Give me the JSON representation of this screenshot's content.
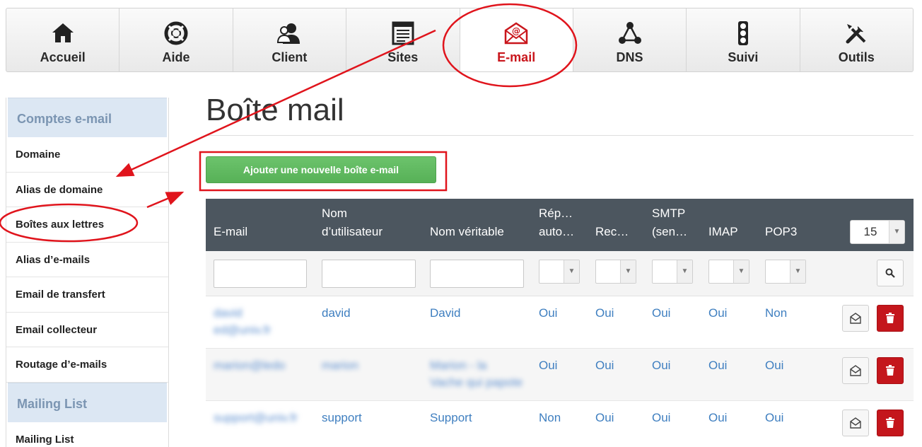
{
  "nav": {
    "items": [
      {
        "label": "Accueil",
        "icon": "home-icon"
      },
      {
        "label": "Aide",
        "icon": "lifebuoy-icon"
      },
      {
        "label": "Client",
        "icon": "users-icon"
      },
      {
        "label": "Sites",
        "icon": "site-icon"
      },
      {
        "label": "E-mail",
        "icon": "email-icon",
        "active": true
      },
      {
        "label": "DNS",
        "icon": "dns-icon"
      },
      {
        "label": "Suivi",
        "icon": "traffic-light-icon"
      },
      {
        "label": "Outils",
        "icon": "tools-icon"
      }
    ]
  },
  "sidebar": {
    "section1": "Comptes e-mail",
    "items": [
      "Domaine",
      "Alias de domaine",
      "Boîtes aux lettres",
      "Alias d’e-mails",
      "Email de transfert",
      "Email collecteur",
      "Routage d’e-mails"
    ],
    "section2": "Mailing List",
    "items2": [
      "Mailing List"
    ]
  },
  "main": {
    "title": "Boîte mail",
    "add_button": "Ajouter une nouvelle boîte e-mail"
  },
  "grid": {
    "headers": {
      "email": "E-mail",
      "username_l1": "Nom",
      "username_l2": "d’utilisateur",
      "realname": "Nom véritable",
      "autoreply_l1": "Rép…",
      "autoreply_l2": "auto…",
      "rec": "Rec…",
      "smtp_l1": "SMTP",
      "smtp_l2": "(sen…",
      "imap": "IMAP",
      "pop3": "POP3"
    },
    "page_size": "15",
    "rows": [
      {
        "email_l1": "david",
        "email_l2": "ed@univ.fr",
        "username": "david",
        "realname_l1": "David",
        "realname_l2": "",
        "autoreply": "Oui",
        "rec": "Oui",
        "smtp": "Oui",
        "imap": "Oui",
        "pop3": "Non"
      },
      {
        "email_l1": "marion@ledo",
        "email_l2": "",
        "username": "marion",
        "realname_l1": "Marion - la",
        "realname_l2": "Vache qui papote",
        "autoreply": "Oui",
        "rec": "Oui",
        "smtp": "Oui",
        "imap": "Oui",
        "pop3": "Oui"
      },
      {
        "email_l1": "support@univ.fr",
        "email_l2": "",
        "username": "support",
        "realname_l1": "Support",
        "realname_l2": "",
        "autoreply": "Non",
        "rec": "Oui",
        "smtp": "Oui",
        "imap": "Oui",
        "pop3": "Oui"
      }
    ]
  },
  "colors": {
    "active_tab": "#c9161c",
    "annotation": "#e0141c",
    "link": "#3f7fc0",
    "grid_header": "#4c565f",
    "add_button": "#5cb85c",
    "delete_button": "#c4161c"
  }
}
